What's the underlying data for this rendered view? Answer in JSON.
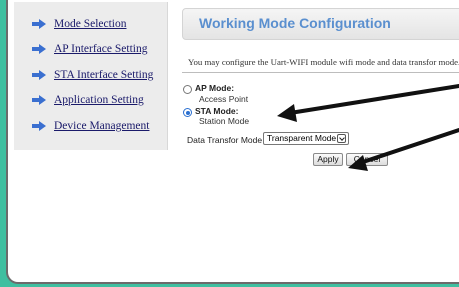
{
  "sidebar": {
    "items": [
      {
        "label": "Mode Selection"
      },
      {
        "label": "AP Interface Setting"
      },
      {
        "label": "STA Interface Setting"
      },
      {
        "label": "Application Setting"
      },
      {
        "label": "Device Management"
      }
    ]
  },
  "main": {
    "title": "Working Mode Configuration",
    "description": "You may configure the Uart-WIFI module wifi mode and data transfor mode.",
    "modes": [
      {
        "title": "AP Mode:",
        "subtitle": "Access Point",
        "checked": false
      },
      {
        "title": "STA Mode:",
        "subtitle": "Station Mode",
        "checked": true
      }
    ],
    "transfer": {
      "label": "Data Transfor Mode",
      "value": "Transparent Mode"
    },
    "buttons": {
      "apply": "Apply",
      "cancel": "Cancel"
    }
  },
  "colors": {
    "background": "#3fbfa0",
    "title": "#5a8fcf",
    "nav_icon": "#3a6fd0",
    "annotation_arrow": "#111111"
  }
}
